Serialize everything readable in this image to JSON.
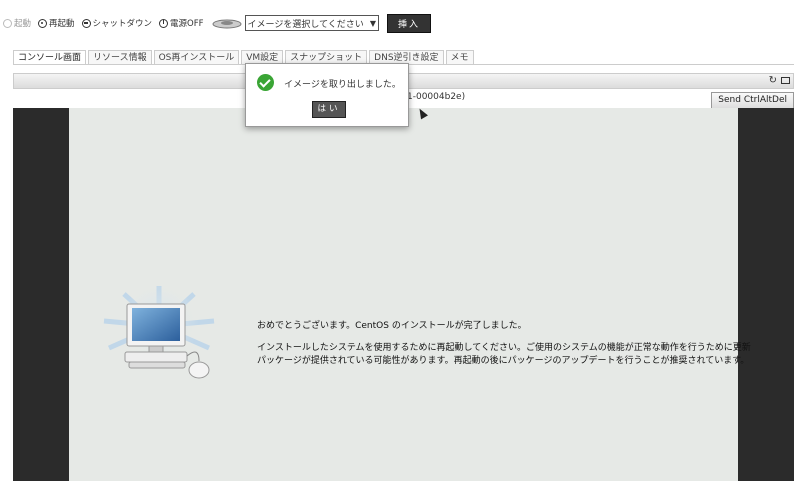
{
  "toolbar": {
    "start": "起動",
    "restart": "再起動",
    "shutdown": "シャットダウン",
    "power_off": "電源OFF",
    "image_select": "イメージを選択してください",
    "insert": "挿入"
  },
  "tabs": [
    "コンソール画面",
    "リソース情報",
    "OS再インストール",
    "VM設定",
    "スナップショット",
    "DNS逆引き設定",
    "メモ"
  ],
  "console": {
    "subtitle": "1-00004b2e)",
    "send_ctrl_alt_del": "Send CtrlAltDel",
    "refresh_icon": "↻",
    "message1": "おめでとうございます。CentOS のインストールが完了しました。",
    "message2": "インストールしたシステムを使用するために再起動してください。ご使用のシステムの機能が正常な動作を行うために更新",
    "message3": "パッケージが提供されている可能性があります。再起動の後にパッケージのアップデートを行うことが推奨されています。"
  },
  "dialog": {
    "message": "イメージを取り出しました。",
    "ok": "はい"
  }
}
